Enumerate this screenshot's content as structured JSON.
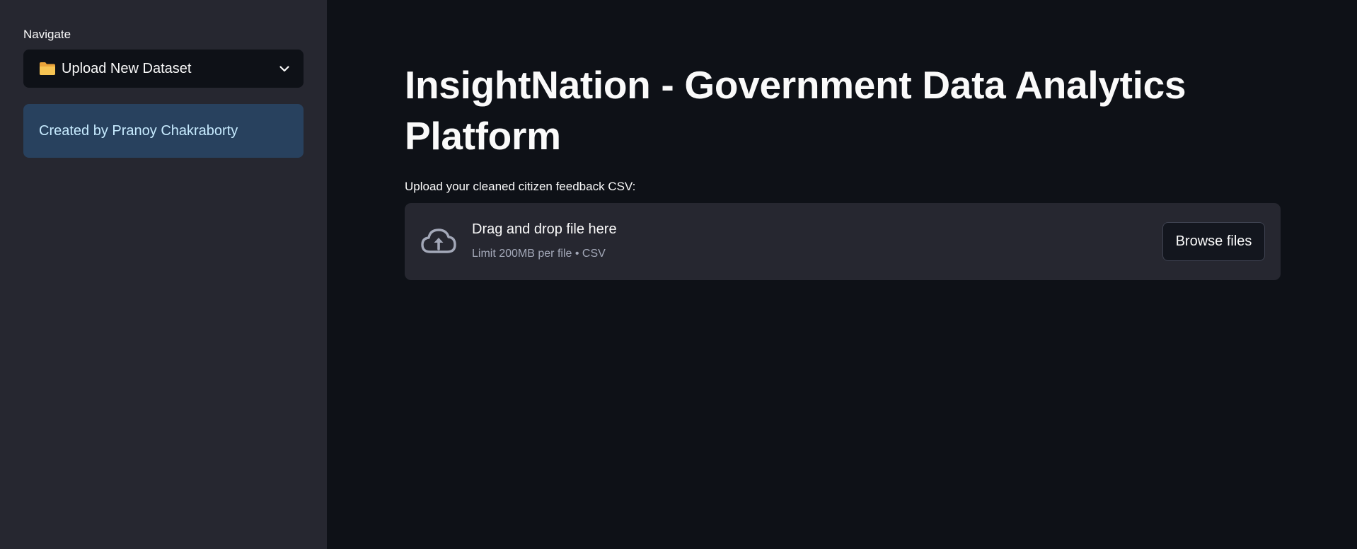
{
  "sidebar": {
    "nav_label": "Navigate",
    "select": {
      "icon": "folder-icon",
      "value": "Upload New Dataset"
    },
    "credit": "Created by Pranoy Chakraborty"
  },
  "main": {
    "title": "InsightNation - Government Data Analytics Platform",
    "upload_label": "Upload your cleaned citizen feedback CSV:",
    "dropzone": {
      "icon": "cloud-upload-icon",
      "primary_text": "Drag and drop file here",
      "secondary_text": "Limit 200MB per file • CSV",
      "button_label": "Browse files"
    }
  },
  "colors": {
    "background": "#0e1117",
    "sidebar": "#262730",
    "info_box": "#28415e",
    "info_text": "#c7ebff",
    "folder": "#f5b942"
  }
}
